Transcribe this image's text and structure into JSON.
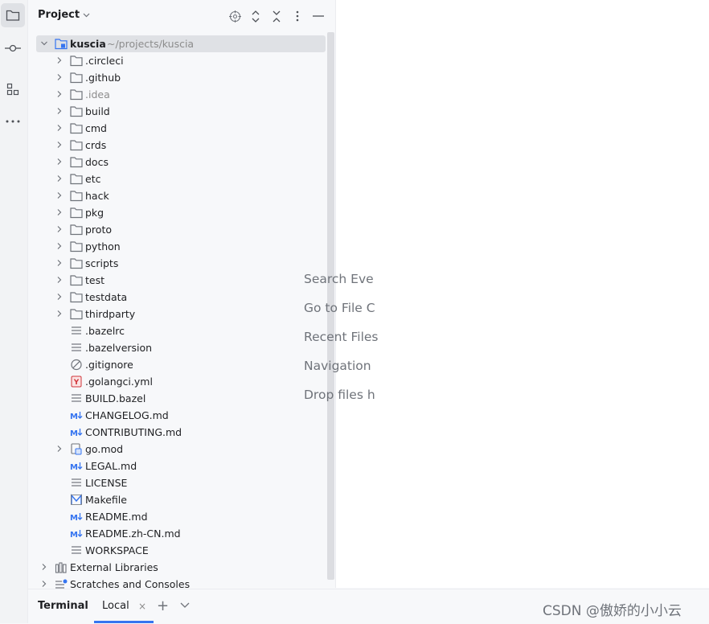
{
  "sidebar_tools": [
    {
      "name": "project-tool",
      "icon": "folder-icon",
      "active": true
    },
    {
      "name": "commit-tool",
      "icon": "commit-icon",
      "active": false
    },
    {
      "name": "structure-tool",
      "icon": "structure-icon",
      "active": false
    },
    {
      "name": "more-tools",
      "icon": "ellipsis-icon",
      "active": false
    }
  ],
  "panel": {
    "title": "Project",
    "actions": [
      "locate-icon",
      "expand-collapse-icon",
      "collapse-all-icon",
      "options-icon",
      "minimize-icon"
    ]
  },
  "tree": {
    "root": {
      "name": "kuscia",
      "path": "~/projects/kuscia"
    },
    "items": [
      {
        "name": ".circleci",
        "type": "folder",
        "expandable": true
      },
      {
        "name": ".github",
        "type": "folder",
        "expandable": true
      },
      {
        "name": ".idea",
        "type": "folder",
        "expandable": true,
        "muted": true
      },
      {
        "name": "build",
        "type": "folder",
        "expandable": true
      },
      {
        "name": "cmd",
        "type": "folder",
        "expandable": true
      },
      {
        "name": "crds",
        "type": "folder",
        "expandable": true
      },
      {
        "name": "docs",
        "type": "folder",
        "expandable": true
      },
      {
        "name": "etc",
        "type": "folder",
        "expandable": true
      },
      {
        "name": "hack",
        "type": "folder",
        "expandable": true
      },
      {
        "name": "pkg",
        "type": "folder",
        "expandable": true
      },
      {
        "name": "proto",
        "type": "folder",
        "expandable": true
      },
      {
        "name": "python",
        "type": "folder",
        "expandable": true
      },
      {
        "name": "scripts",
        "type": "folder",
        "expandable": true
      },
      {
        "name": "test",
        "type": "folder",
        "expandable": true
      },
      {
        "name": "testdata",
        "type": "folder",
        "expandable": true
      },
      {
        "name": "thirdparty",
        "type": "folder",
        "expandable": true
      },
      {
        "name": ".bazelrc",
        "type": "text",
        "expandable": false
      },
      {
        "name": ".bazelversion",
        "type": "text",
        "expandable": false
      },
      {
        "name": ".gitignore",
        "type": "ignore",
        "expandable": false
      },
      {
        "name": ".golangci.yml",
        "type": "yaml",
        "expandable": false
      },
      {
        "name": "BUILD.bazel",
        "type": "text",
        "expandable": false
      },
      {
        "name": "CHANGELOG.md",
        "type": "markdown",
        "expandable": false
      },
      {
        "name": "CONTRIBUTING.md",
        "type": "markdown",
        "expandable": false
      },
      {
        "name": "go.mod",
        "type": "gomod",
        "expandable": true
      },
      {
        "name": "LEGAL.md",
        "type": "markdown",
        "expandable": false
      },
      {
        "name": "LICENSE",
        "type": "text",
        "expandable": false
      },
      {
        "name": "Makefile",
        "type": "makefile",
        "expandable": false
      },
      {
        "name": "README.md",
        "type": "markdown",
        "expandable": false
      },
      {
        "name": "README.zh-CN.md",
        "type": "markdown",
        "expandable": false
      },
      {
        "name": "WORKSPACE",
        "type": "text",
        "expandable": false
      }
    ],
    "external": [
      {
        "name": "External Libraries",
        "icon": "library-icon"
      },
      {
        "name": "Scratches and Consoles",
        "icon": "scratches-icon"
      }
    ]
  },
  "editor_hints": [
    "Search Eve",
    "Go to File C",
    "Recent Files",
    "Navigation",
    "Drop files h"
  ],
  "bottom": {
    "title": "Terminal",
    "tab_label": "Local",
    "close_glyph": "×",
    "plus_glyph": "+"
  },
  "watermark": "CSDN @傲娇的小小云",
  "colors": {
    "accent": "#3574f0",
    "yaml": "#d1353a",
    "markdown": "#3574f0",
    "folder_stroke": "#6f737a"
  }
}
